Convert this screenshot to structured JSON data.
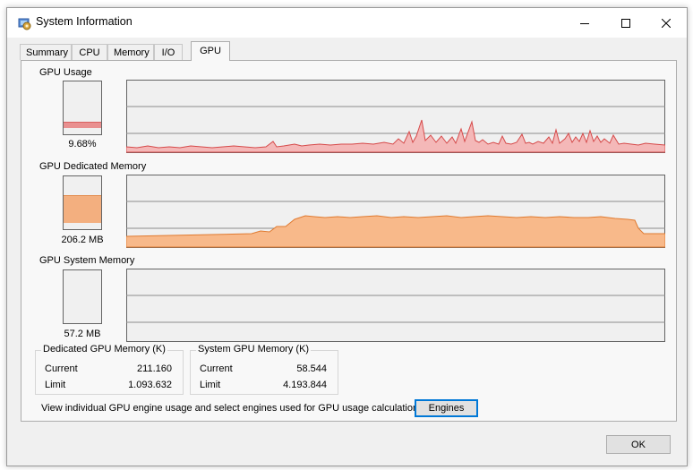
{
  "window": {
    "title": "System Information",
    "icon": "system-information-icon"
  },
  "tabs": [
    {
      "label": "Summary"
    },
    {
      "label": "CPU"
    },
    {
      "label": "Memory"
    },
    {
      "label": "I/O"
    },
    {
      "label": "GPU",
      "active": true
    }
  ],
  "gpu_usage": {
    "label": "GPU Usage",
    "value": "9.68%",
    "level": 0.0968,
    "color": "#e88080"
  },
  "gpu_dedicated": {
    "label": "GPU Dedicated Memory",
    "value": "206.2 MB",
    "level": 0.5,
    "color": "#f4a46c"
  },
  "gpu_system": {
    "label": "GPU System Memory",
    "value": "57.2 MB",
    "level": 0.0
  },
  "dedicated_group": {
    "title": "Dedicated GPU Memory (K)",
    "current_label": "Current",
    "current_value": "211.160",
    "limit_label": "Limit",
    "limit_value": "1.093.632"
  },
  "system_group": {
    "title": "System GPU Memory (K)",
    "current_label": "Current",
    "current_value": "58.544",
    "limit_label": "Limit",
    "limit_value": "4.193.844"
  },
  "engines_text": "View individual GPU engine usage and select engines used for GPU usage calculations:",
  "engines_button": "Engines",
  "ok_button": "OK"
}
